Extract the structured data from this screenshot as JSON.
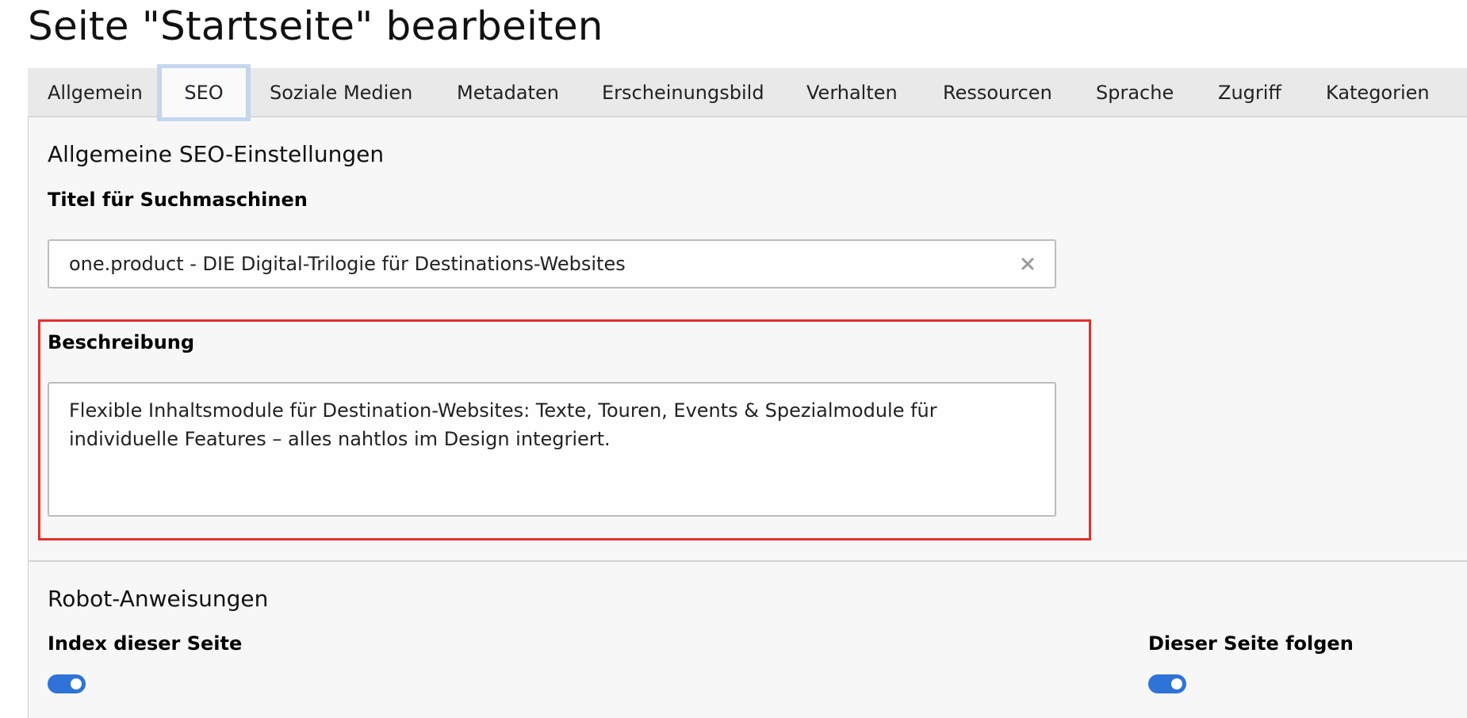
{
  "page": {
    "title": "Seite \"Startseite\" bearbeiten"
  },
  "tabs": [
    {
      "label": "Allgemein",
      "active": false
    },
    {
      "label": "SEO",
      "active": true
    },
    {
      "label": "Soziale Medien",
      "active": false
    },
    {
      "label": "Metadaten",
      "active": false
    },
    {
      "label": "Erscheinungsbild",
      "active": false
    },
    {
      "label": "Verhalten",
      "active": false
    },
    {
      "label": "Ressourcen",
      "active": false
    },
    {
      "label": "Sprache",
      "active": false
    },
    {
      "label": "Zugriff",
      "active": false
    },
    {
      "label": "Kategorien",
      "active": false
    }
  ],
  "seo_general": {
    "heading": "Allgemeine SEO-Einstellungen",
    "title_label": "Titel für Suchmaschinen",
    "title_value": "one.product - DIE Digital-Trilogie für Destinations-Websites",
    "clear_icon": "close-x-icon",
    "description_label": "Beschreibung",
    "description_value": "Flexible Inhaltsmodule für Destination-Websites: Texte, Touren, Events & Spezialmodule für individuelle Features – alles nahtlos im Design integriert."
  },
  "robots": {
    "heading": "Robot-Anweisungen",
    "index_label": "Index dieser Seite",
    "index_enabled": true,
    "follow_label": "Dieser Seite folgen",
    "follow_enabled": true
  },
  "colors": {
    "accent": "#2f73d9",
    "highlight_border": "#e3312c",
    "active_tab_ring": "#c3d7ef"
  }
}
